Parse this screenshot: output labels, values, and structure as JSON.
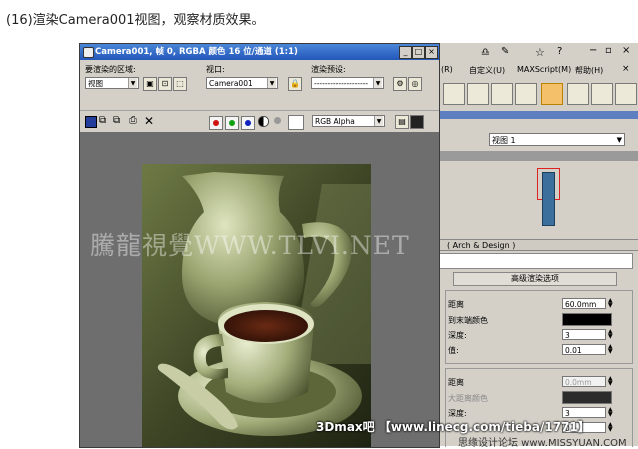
{
  "caption": "(16)渲染Camera001视图，观察材质效果。",
  "render_window": {
    "title": "Camera001, 帧 0, RGBA 颜色 16 位/通道 (1:1)",
    "area_label": "要渲染的区域:",
    "area_value": "视图",
    "viewport_label": "视口:",
    "viewport_value": "Camera001",
    "preset_label": "渲染预设:",
    "preset_value": "--------------------",
    "channel_value": "RGB Alpha",
    "watermark": "騰龍視覺WWW.TLVI.NET"
  },
  "max_ui": {
    "menu": [
      "(R)",
      "自定义(U)",
      "MAXScript(M)",
      "帮助(H)"
    ],
    "view_combo": "视图 1",
    "material_panel": "( Arch & Design )",
    "advanced_rollout": "高级渲染选项",
    "group1": {
      "distance_label": "距离",
      "distance_value": "60.0mm",
      "color_label": "到末端颜色",
      "val1_label": "深度:",
      "val1": "3",
      "val2_label": "值:",
      "val2": "0.01"
    },
    "group2": {
      "distance_label": "距离",
      "distance_value": "0.0mm",
      "color_label": "大距离颜色",
      "val1_label": "深度:",
      "val1": "3",
      "val2": "0.1"
    }
  },
  "footer": {
    "watermark1": "3Dmax吧 【www.linecg.com/tieba/1771】",
    "watermark2": "思缘设计论坛 www.MISSYUAN.COM"
  },
  "colors": {
    "titlebar": "#2a62c5",
    "ui_grey": "#d4d0c8",
    "material_blue": "#3d6f9c"
  }
}
